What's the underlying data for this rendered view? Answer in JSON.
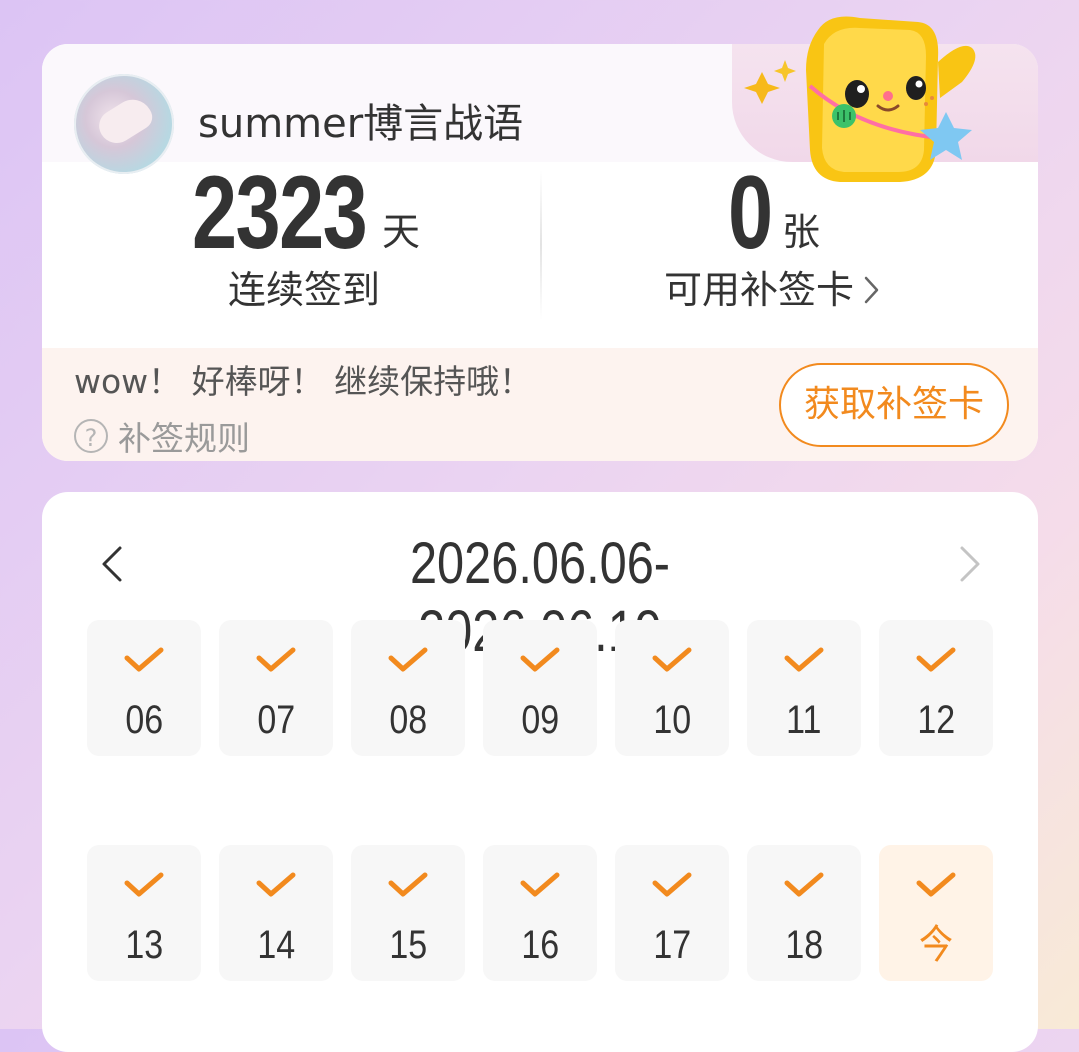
{
  "header": {
    "username": "summer博言战语",
    "streak": {
      "value": "2323",
      "unit": "天",
      "label": "连续签到"
    },
    "makeup_cards": {
      "value": "0",
      "unit": "张",
      "label": "可用补签卡"
    },
    "message": "wow！ 好棒呀！ 继续保持哦！",
    "rules_label": "补签规则",
    "get_card_button": "获取补签卡"
  },
  "calendar": {
    "range": "2026.06.06-2026.06.19",
    "days": [
      {
        "label": "06",
        "checked": true
      },
      {
        "label": "07",
        "checked": true
      },
      {
        "label": "08",
        "checked": true
      },
      {
        "label": "09",
        "checked": true
      },
      {
        "label": "10",
        "checked": true
      },
      {
        "label": "11",
        "checked": true
      },
      {
        "label": "12",
        "checked": true
      },
      {
        "label": "13",
        "checked": true
      },
      {
        "label": "14",
        "checked": true
      },
      {
        "label": "15",
        "checked": true
      },
      {
        "label": "16",
        "checked": true
      },
      {
        "label": "17",
        "checked": true
      },
      {
        "label": "18",
        "checked": true
      },
      {
        "label": "今",
        "checked": true,
        "today": true
      }
    ]
  },
  "colors": {
    "accent": "#f28a1e",
    "text": "#333333",
    "muted": "#9a9a9a"
  }
}
